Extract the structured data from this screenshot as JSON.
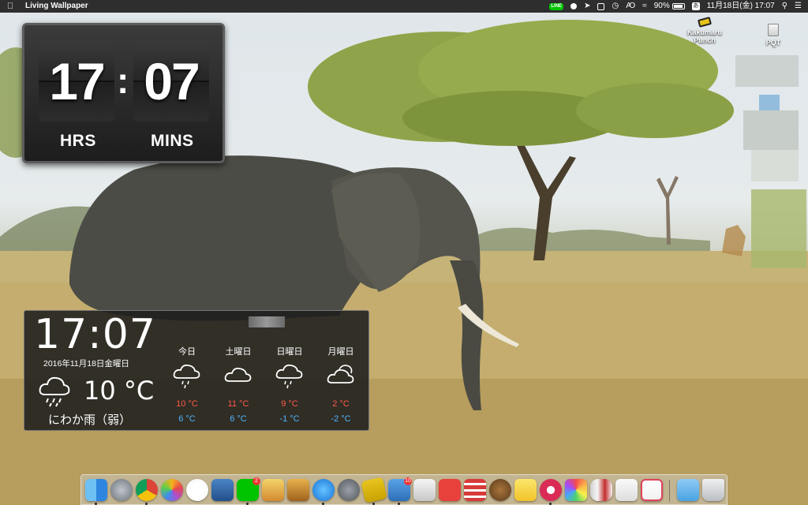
{
  "menubar": {
    "app_name": "Living Wallpaper",
    "line_label": "LINE",
    "battery": "90%",
    "ime": "あ",
    "datetime": "11月18日(金) 17:07"
  },
  "desktop_icons": [
    {
      "label_line1": "Kakumaru",
      "label_line2": "Punch"
    },
    {
      "label_line1": "PQT",
      "label_line2": ""
    }
  ],
  "flip_clock": {
    "hours": "17",
    "minutes": "07",
    "hours_label": "HRS",
    "minutes_label": "MINS"
  },
  "weather": {
    "time": "17:07",
    "date": "2016年11月18日金曜日",
    "current_temp": "10 °C",
    "condition": "にわか雨（弱）",
    "forecast": [
      {
        "day": "今日",
        "high": "10 °C",
        "low": "6 °C",
        "icon": "rain-cloud-icon"
      },
      {
        "day": "土曜日",
        "high": "11 °C",
        "low": "6 °C",
        "icon": "cloud-icon"
      },
      {
        "day": "日曜日",
        "high": "9 °C",
        "low": "-1 °C",
        "icon": "rain-cloud-icon"
      },
      {
        "day": "月曜日",
        "high": "2 °C",
        "low": "-2 °C",
        "icon": "cloud-icon"
      }
    ]
  },
  "dock": {
    "finder_name": "finder-icon",
    "line_badge": "2",
    "mail_badge": "10"
  }
}
